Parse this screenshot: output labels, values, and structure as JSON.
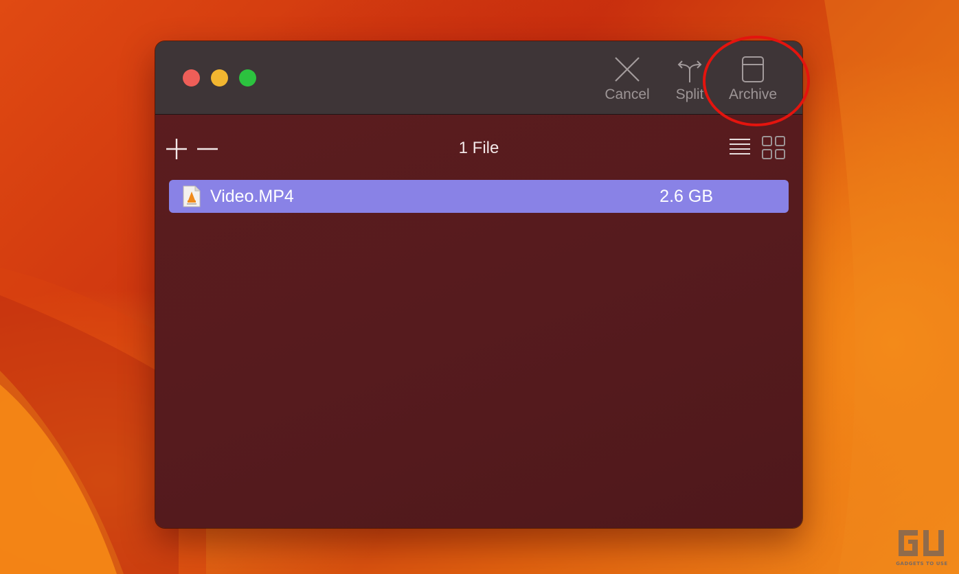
{
  "window": {
    "toolbar": {
      "cancel_label": "Cancel",
      "split_label": "Split",
      "archive_label": "Archive"
    },
    "file_count": "1 File",
    "files": [
      {
        "name": "Video.MP4",
        "size": "2.6 GB",
        "icon": "vlc-file-icon"
      }
    ]
  },
  "annotation": {
    "color": "#e4140e",
    "target": "Archive"
  },
  "watermark": {
    "caption": "GADGETS TO USE"
  },
  "colors": {
    "selection": "#8982e6",
    "titlebar": "#3e3537",
    "window_body": "#5a1c1f"
  }
}
